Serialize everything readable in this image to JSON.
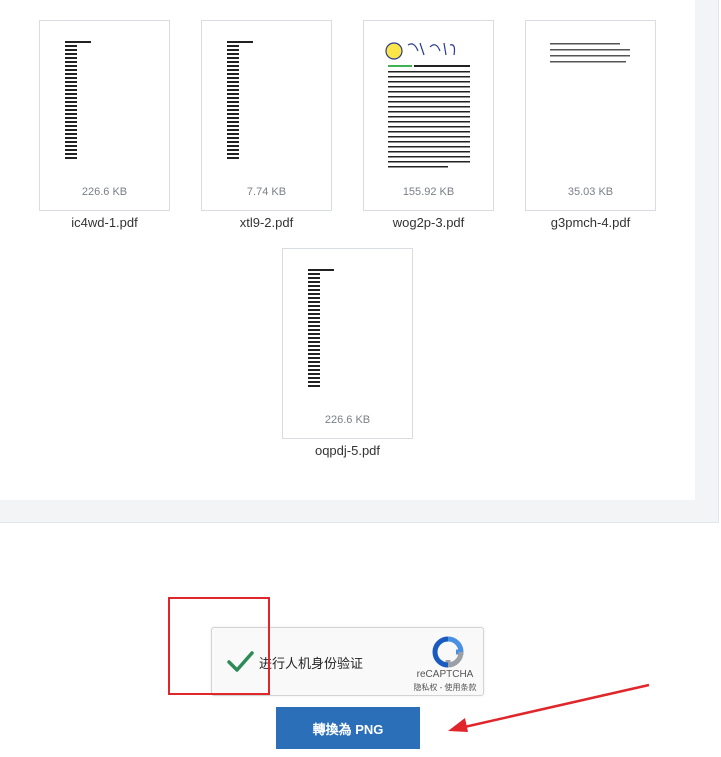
{
  "files": [
    {
      "name": "ic4wd-1.pdf",
      "size": "226.6 KB",
      "preview": "text-column"
    },
    {
      "name": "xtl9-2.pdf",
      "size": "7.74 KB",
      "preview": "text-column"
    },
    {
      "name": "wog2p-3.pdf",
      "size": "155.92 KB",
      "preview": "chinese-document"
    },
    {
      "name": "g3pmch-4.pdf",
      "size": "35.03 KB",
      "preview": "short-text"
    },
    {
      "name": "oqpdj-5.pdf",
      "size": "226.6 KB",
      "preview": "text-column"
    }
  ],
  "captcha": {
    "label": "进行人机身份验证",
    "brand": "reCAPTCHA",
    "terms": "隐私权 - 使用条款",
    "checked": true
  },
  "convert_button": {
    "label": "轉換為 PNG"
  },
  "colors": {
    "button": "#2a6fb8",
    "annotation": "#e0262b",
    "check": "#2e8b57"
  }
}
